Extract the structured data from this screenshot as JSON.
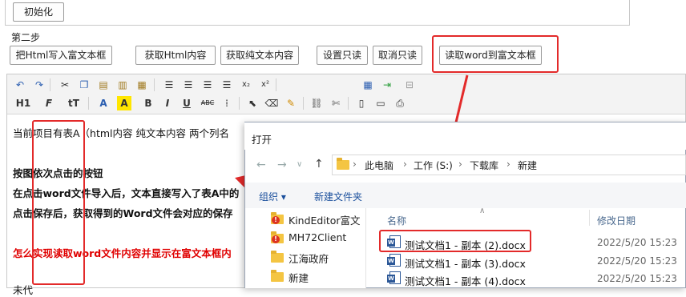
{
  "top": {
    "init_button": "初始化"
  },
  "step2": {
    "label": "第二步",
    "buttons": [
      "把Html写入富文本框",
      "获取Html内容",
      "获取纯文本内容",
      "设置只读",
      "取消只读",
      "读取word到富文本框"
    ]
  },
  "toolbar": {
    "row1": [
      "undo-icon",
      "redo-icon",
      "cut-icon",
      "copy-icon",
      "paste-icon",
      "paste-text-icon",
      "paste-word-icon",
      "align-left-icon",
      "align-center-icon",
      "align-right-icon",
      "justify-icon",
      "subscript-icon",
      "superscript-icon",
      "table-icon",
      "insert-row-icon",
      "page-break-icon"
    ],
    "row2_labels": {
      "heading": "H1",
      "font": "F",
      "size": "tT",
      "color": "A",
      "bg": "A",
      "bold": "B",
      "italic": "I",
      "underline": "U",
      "strike": "ABC"
    }
  },
  "content": {
    "line1": "当前项目有表A（html内容  纯文本内容  两个列名",
    "line2": "按图依次点击的按钮",
    "line3": "在点击word文件导入后，文本直接写入了表A中的",
    "line4": "点击保存后，获取得到的Word文件会对应的保存",
    "line5": "怎么实现读取word文件内容并显示在富文本框内",
    "line6": "未代"
  },
  "dialog": {
    "title": "打开",
    "path": [
      "此电脑",
      "工作 (S:)",
      "下载库",
      "新建"
    ],
    "organize": "组织 ▾",
    "new_folder": "新建文件夹",
    "tree": [
      {
        "label": "KindEditor富文",
        "icon": "folder-alert-icon"
      },
      {
        "label": "MH72Client",
        "icon": "folder-alert-icon"
      },
      {
        "label": "江海政府",
        "icon": "folder-icon"
      },
      {
        "label": "新建",
        "icon": "folder-icon"
      }
    ],
    "col_name": "名称",
    "col_date": "修改日期",
    "files": [
      {
        "name": "测试文档1 - 副本 (2).docx",
        "date": "2022/5/20 15:23"
      },
      {
        "name": "测试文档1 - 副本 (3).docx",
        "date": "2022/5/20 15:23"
      },
      {
        "name": "测试文档1 - 副本 (4).docx",
        "date": "2022/5/20 15:23"
      }
    ]
  },
  "colors": {
    "highlight_red": "#e32a2a",
    "text_red": "#e00000"
  }
}
